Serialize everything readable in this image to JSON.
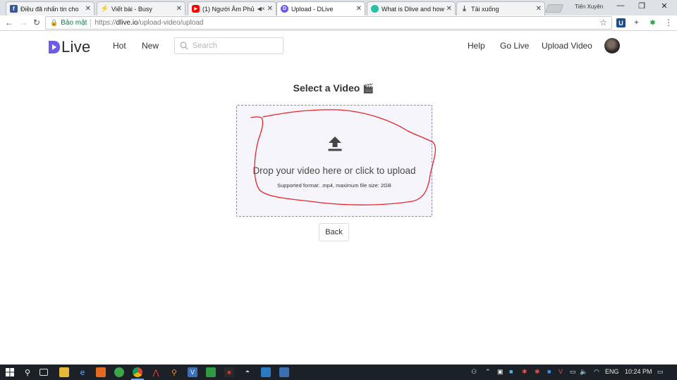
{
  "browser": {
    "tabs": [
      {
        "title": "Điều đã nhấn tin cho",
        "icon": "facebook-icon",
        "color": "#3b5998",
        "active": false
      },
      {
        "title": "Viết bài - Busy",
        "icon": "busy-bolt-icon",
        "color": "#333333",
        "active": false
      },
      {
        "title": "(1) Người Âm Phủ |",
        "icon": "youtube-icon",
        "color": "#ff0000",
        "active": false,
        "muted": true
      },
      {
        "title": "Upload - DLive",
        "icon": "dlive-icon",
        "color": "#6c5ce7",
        "active": true
      },
      {
        "title": "What is Dlive and how",
        "icon": "dlive-teal-icon",
        "color": "#28c1a8",
        "active": false
      },
      {
        "title": "Tải xuống",
        "icon": "download-icon",
        "color": "#555555",
        "active": false
      }
    ],
    "profile_name": "Tiến Xuyên",
    "secure_label": "Bảo mật",
    "url": {
      "protocol": "https://",
      "host": "dlive.io",
      "path": "/upload-video/upload"
    }
  },
  "site": {
    "logo_text": "Live",
    "logo_color": "#6c5ce7",
    "nav": {
      "hot": "Hot",
      "new": "New"
    },
    "search_placeholder": "Search",
    "right_nav": {
      "help": "Help",
      "golive": "Go Live",
      "upload": "Upload Video"
    }
  },
  "main": {
    "heading": "Select a Video",
    "heading_emoji": "🎬",
    "dropzone": {
      "title": "Drop your video here or click to upload",
      "subtitle": "Supported format: .mp4, maximum file size: 2GB",
      "border_color": "#8a82d8"
    },
    "back_label": "Back",
    "annotation_color": "#e8232a"
  },
  "taskbar": {
    "language": "ENG",
    "time": "10:24 PM"
  }
}
